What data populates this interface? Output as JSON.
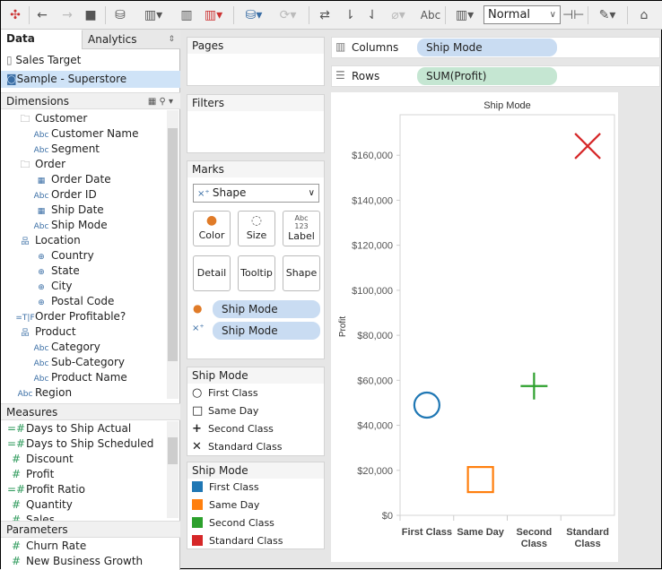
{
  "toolbar": {
    "icons": [
      "tableau-logo-icon",
      "undo-icon",
      "redo-icon",
      "save-icon",
      "new-datasource-icon",
      "new-worksheet-icon",
      "duplicate-icon",
      "clear-icon",
      "datasource-pause-icon",
      "refresh-icon",
      "swap-icon",
      "sort-asc-icon",
      "sort-desc-icon",
      "group-icon",
      "show-labels-icon",
      "show-me-icon",
      "fix-axes-icon",
      "highlight-icon",
      "presentation-icon"
    ],
    "label_text": "Abc",
    "fit_value": "Normal"
  },
  "left": {
    "tabs": [
      "Data",
      "Analytics"
    ],
    "datasources": [
      {
        "label": "Sales Target",
        "selected": false
      },
      {
        "label": "Sample - Superstore",
        "selected": true
      }
    ],
    "dimensions_title": "Dimensions",
    "dimensions": [
      {
        "label": "Customer",
        "type": "folder",
        "level": 0
      },
      {
        "label": "Customer Name",
        "type": "Abc",
        "level": 1
      },
      {
        "label": "Segment",
        "type": "Abc",
        "level": 1
      },
      {
        "label": "Order",
        "type": "folder",
        "level": 0
      },
      {
        "label": "Order Date",
        "type": "date",
        "level": 1
      },
      {
        "label": "Order ID",
        "type": "Abc",
        "level": 1
      },
      {
        "label": "Ship Date",
        "type": "date",
        "level": 1
      },
      {
        "label": "Ship Mode",
        "type": "Abc",
        "level": 1
      },
      {
        "label": "Location",
        "type": "hierarchy",
        "level": 0
      },
      {
        "label": "Country",
        "type": "geo",
        "level": 1
      },
      {
        "label": "State",
        "type": "geo",
        "level": 1
      },
      {
        "label": "City",
        "type": "geo",
        "level": 1
      },
      {
        "label": "Postal Code",
        "type": "geo",
        "level": 1
      },
      {
        "label": "Order Profitable?",
        "type": "bool",
        "level": 0
      },
      {
        "label": "Product",
        "type": "hierarchy",
        "level": 0
      },
      {
        "label": "Category",
        "type": "Abc",
        "level": 1
      },
      {
        "label": "Sub-Category",
        "type": "Abc",
        "level": 1
      },
      {
        "label": "Product Name",
        "type": "Abc",
        "level": 1
      },
      {
        "label": "Region",
        "type": "Abc",
        "level": 0
      }
    ],
    "measures_title": "Measures",
    "measures": [
      {
        "label": "Days to Ship Actual",
        "calc": true
      },
      {
        "label": "Days to Ship Scheduled",
        "calc": true
      },
      {
        "label": "Discount",
        "calc": false
      },
      {
        "label": "Profit",
        "calc": false
      },
      {
        "label": "Profit Ratio",
        "calc": true
      },
      {
        "label": "Quantity",
        "calc": false
      },
      {
        "label": "Sales",
        "calc": false
      }
    ],
    "parameters_title": "Parameters",
    "parameters": [
      "Churn Rate",
      "New Business Growth"
    ]
  },
  "cards": {
    "pages": "Pages",
    "filters": "Filters",
    "marks": "Marks",
    "mark_type": "Shape",
    "mark_buttons": [
      "Color",
      "Size",
      "Label",
      "Detail",
      "Tooltip",
      "Shape"
    ],
    "label_glyph": "Abc\n123",
    "mark_fields": [
      {
        "icon": "color-icon",
        "label": "Ship Mode"
      },
      {
        "icon": "shape-icon",
        "label": "Ship Mode"
      }
    ],
    "shape_legend": {
      "title": "Ship Mode",
      "items": [
        {
          "label": "First Class",
          "shape": "circle"
        },
        {
          "label": "Same Day",
          "shape": "square"
        },
        {
          "label": "Second Class",
          "shape": "plus"
        },
        {
          "label": "Standard Class",
          "shape": "cross"
        }
      ]
    },
    "color_legend": {
      "title": "Ship Mode",
      "items": [
        {
          "label": "First Class",
          "color": "#1f77b4"
        },
        {
          "label": "Same Day",
          "color": "#ff7f0e"
        },
        {
          "label": "Second Class",
          "color": "#2ca02c"
        },
        {
          "label": "Standard Class",
          "color": "#d62728"
        }
      ]
    }
  },
  "shelves": {
    "columns_label": "Columns",
    "columns_pill": "Ship Mode",
    "rows_label": "Rows",
    "rows_pill": "SUM(Profit)"
  },
  "chart_data": {
    "type": "scatter",
    "title": "Ship Mode",
    "ylabel": "Profit",
    "categories": [
      "First Class",
      "Same Day",
      "Second Class",
      "Standard Class"
    ],
    "category_labels": [
      [
        "First Class"
      ],
      [
        "Same Day"
      ],
      [
        "Second",
        "Class"
      ],
      [
        "Standard",
        "Class"
      ]
    ],
    "values": [
      48969,
      15892,
      57447,
      164089
    ],
    "shapes": [
      "circle",
      "square",
      "plus",
      "cross"
    ],
    "colors": [
      "#1f77b4",
      "#ff7f0e",
      "#2ca02c",
      "#d62728"
    ],
    "ylim": [
      0,
      178000
    ],
    "yticks": [
      0,
      20000,
      40000,
      60000,
      80000,
      100000,
      120000,
      140000,
      160000
    ],
    "ytick_labels": [
      "$0",
      "$20,000",
      "$40,000",
      "$60,000",
      "$80,000",
      "$100,000",
      "$120,000",
      "$140,000",
      "$160,000"
    ],
    "grid": false
  }
}
